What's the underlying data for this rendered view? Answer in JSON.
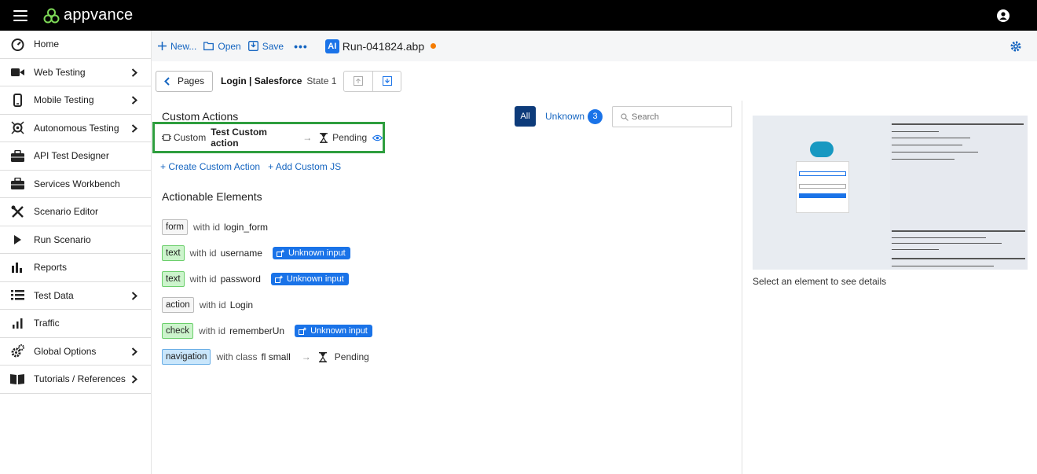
{
  "app": {
    "brand": "appvance"
  },
  "sidebar": {
    "items": [
      {
        "label": "Home",
        "icon": "speedometer-icon",
        "chevron": false
      },
      {
        "label": "Web Testing",
        "icon": "video-camera-icon",
        "chevron": true
      },
      {
        "label": "Mobile Testing",
        "icon": "mobile-phone-icon",
        "chevron": true
      },
      {
        "label": "Autonomous Testing",
        "icon": "ai-brain-icon",
        "chevron": true
      },
      {
        "label": "API Test Designer",
        "icon": "briefcase-icon",
        "chevron": false
      },
      {
        "label": "Services Workbench",
        "icon": "briefcase-icon",
        "chevron": false
      },
      {
        "label": "Scenario Editor",
        "icon": "tools-icon",
        "chevron": false
      },
      {
        "label": "Run Scenario",
        "icon": "play-icon",
        "chevron": false
      },
      {
        "label": "Reports",
        "icon": "bar-chart-icon",
        "chevron": false
      },
      {
        "label": "Test Data",
        "icon": "list-icon",
        "chevron": true
      },
      {
        "label": "Traffic",
        "icon": "signal-bars-icon",
        "chevron": false
      },
      {
        "label": "Global Options",
        "icon": "gears-icon",
        "chevron": true
      },
      {
        "label": "Tutorials / References",
        "icon": "book-icon",
        "chevron": true
      }
    ]
  },
  "toolbar": {
    "new_label": "New...",
    "open_label": "Open",
    "save_label": "Save",
    "more_label": "•••",
    "file_badge": "AI",
    "file_name": "Run-041824.abp"
  },
  "pagebar": {
    "pages_label": "Pages",
    "page_name": "Login | Salesforce",
    "state": "State 1"
  },
  "custom_actions": {
    "title": "Custom Actions",
    "filter_all": "All",
    "filter_unknown": "Unknown",
    "unknown_count": "3",
    "search_placeholder": "Search",
    "item": {
      "kind": "Custom",
      "name": "Test Custom action",
      "arrow": "→",
      "status": "Pending"
    },
    "create_link": "+ Create Custom Action",
    "add_js_link": "+ Add Custom JS"
  },
  "actionable": {
    "title": "Actionable Elements",
    "rows": [
      {
        "tag": "form",
        "color": "gray",
        "with": "with id",
        "ident": "login_form",
        "badge": ""
      },
      {
        "tag": "text",
        "color": "green",
        "with": "with id",
        "ident": "username",
        "badge": "Unknown input"
      },
      {
        "tag": "text",
        "color": "green",
        "with": "with id",
        "ident": "password",
        "badge": "Unknown input"
      },
      {
        "tag": "action",
        "color": "gray",
        "with": "with id",
        "ident": "Login",
        "badge": ""
      },
      {
        "tag": "check",
        "color": "green",
        "with": "with id",
        "ident": "rememberUn",
        "badge": "Unknown input"
      },
      {
        "tag": "navigation",
        "color": "blue",
        "with": "with class",
        "ident": "fl small",
        "arrow": "→",
        "status": "Pending"
      }
    ]
  },
  "details": {
    "hint": "Select an element to see details"
  },
  "colors": {
    "accent": "#1a73e8",
    "highlight": "#2e9e3e",
    "topbar": "#000000",
    "unsaved_dot": "#f57c00"
  }
}
